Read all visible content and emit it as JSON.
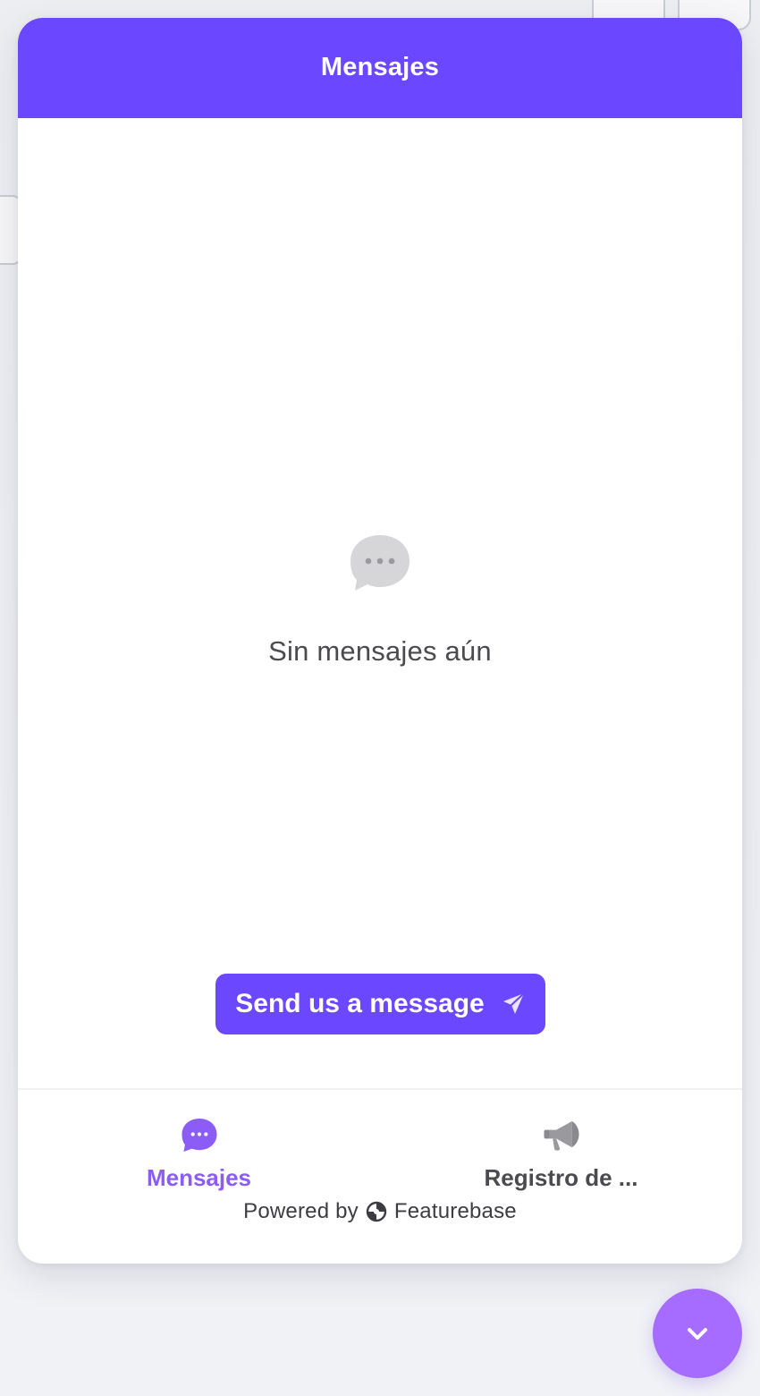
{
  "colors": {
    "accent": "#6b48ff",
    "active_tab": "#8b5cf6",
    "launcher": "#a66bff",
    "empty_icon": "#d6d6d8",
    "inactive_icon": "#9a9a9e"
  },
  "header": {
    "title": "Mensajes"
  },
  "empty_state": {
    "icon": "chat-bubble-dots-icon",
    "text": "Sin mensajes aún"
  },
  "send_button": {
    "label": "Send us a message",
    "icon": "paper-plane-icon"
  },
  "nav": {
    "items": [
      {
        "label": "Mensajes",
        "icon": "chat-bubble-dots-icon",
        "active": true
      },
      {
        "label": "Registro de ...",
        "icon": "megaphone-icon",
        "active": false
      }
    ]
  },
  "footer": {
    "powered_by": "Powered by",
    "brand": "Featurebase",
    "brand_icon": "featurebase-logo-icon"
  },
  "launcher": {
    "icon": "chevron-down-icon"
  }
}
